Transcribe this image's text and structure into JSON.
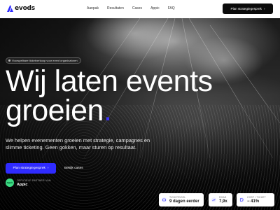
{
  "brand": {
    "name": "evods",
    "accent": "#2f2bff"
  },
  "nav": {
    "links": [
      "Aanpak",
      "Resultaten",
      "Cases",
      "Appic",
      "FAQ"
    ],
    "cta_label": "Plan strategiegesprek",
    "cta_icon": "arrow-right-icon"
  },
  "hero": {
    "pill_text": "Voorspelbare ticketverkoop voor event organisatoren",
    "headline_line1": "Wij laten events",
    "headline_line2": "groeien",
    "headline_dot": ".",
    "lead": "We helpen evenementen groeien met strategie, campagnes en slimme ticketing. Geen gokken, maar sturen op resultaat.",
    "primary_cta": "Plan strategiegesprek",
    "secondary_cta": "Bekijk cases"
  },
  "partner": {
    "badge_text": "appic",
    "label": "OFFICIELE PARTNER VAN",
    "name": "Appic"
  },
  "stats": [
    {
      "label": "TICKETDOEL",
      "value": "9 dagen eerder",
      "icon": "ticket-icon"
    },
    {
      "label": "ROAS",
      "value": "7,9x",
      "icon": "chart-icon"
    },
    {
      "label": "COST / TICKET",
      "value": "− 41%",
      "icon": "tag-icon"
    }
  ],
  "colors": {
    "nav_bg": "#ffffff",
    "cta_dark": "#0b0b0b",
    "partner_green": "#3ddc84"
  }
}
